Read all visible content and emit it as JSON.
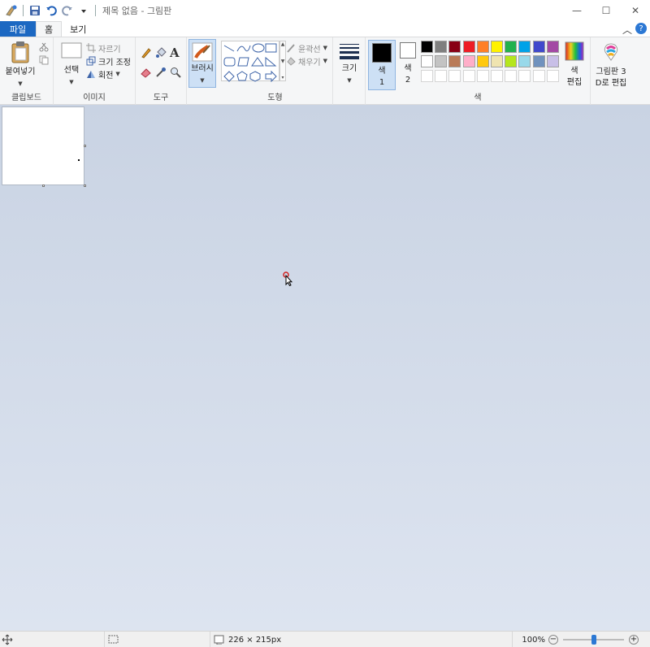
{
  "window": {
    "title": "제목 없음 - 그림판",
    "min": "—",
    "max": "☐",
    "close": "✕"
  },
  "tabs": {
    "file": "파일",
    "home": "홈",
    "view": "보기"
  },
  "ribbon": {
    "clipboard": {
      "label": "클립보드",
      "paste": "붙여넣기"
    },
    "image": {
      "label": "이미지",
      "select": "선택",
      "crop": "자르기",
      "resize": "크기 조정",
      "rotate": "회전"
    },
    "tools": {
      "label": "도구",
      "text_glyph": "A"
    },
    "brushes": {
      "label": "브러시"
    },
    "shapes": {
      "label": "도형",
      "outline": "윤곽선",
      "fill": "채우기"
    },
    "size": {
      "label": "크기"
    },
    "colors": {
      "label": "색",
      "color1_line1": "색",
      "color1_line2": "1",
      "color2_line1": "색",
      "color2_line2": "2",
      "edit_line1": "색",
      "edit_line2": "편집",
      "palette_row1": [
        "#000000",
        "#7f7f7f",
        "#880015",
        "#ed1c24",
        "#ff7f27",
        "#fff200",
        "#22b14c",
        "#00a2e8",
        "#3f48cc",
        "#a349a4"
      ],
      "palette_row2": [
        "#ffffff",
        "#c3c3c3",
        "#b97a57",
        "#ffaec9",
        "#ffc90e",
        "#efe4b0",
        "#b5e61d",
        "#99d9ea",
        "#7092be",
        "#c8bfe7"
      ],
      "color1": "#000000",
      "color2": "#ffffff"
    },
    "paint3d": {
      "line1": "그림판 3",
      "line2": "D로 편집"
    }
  },
  "status": {
    "dimensions": "226 × 215px",
    "zoom": "100%",
    "zoom_level": 0.5
  }
}
